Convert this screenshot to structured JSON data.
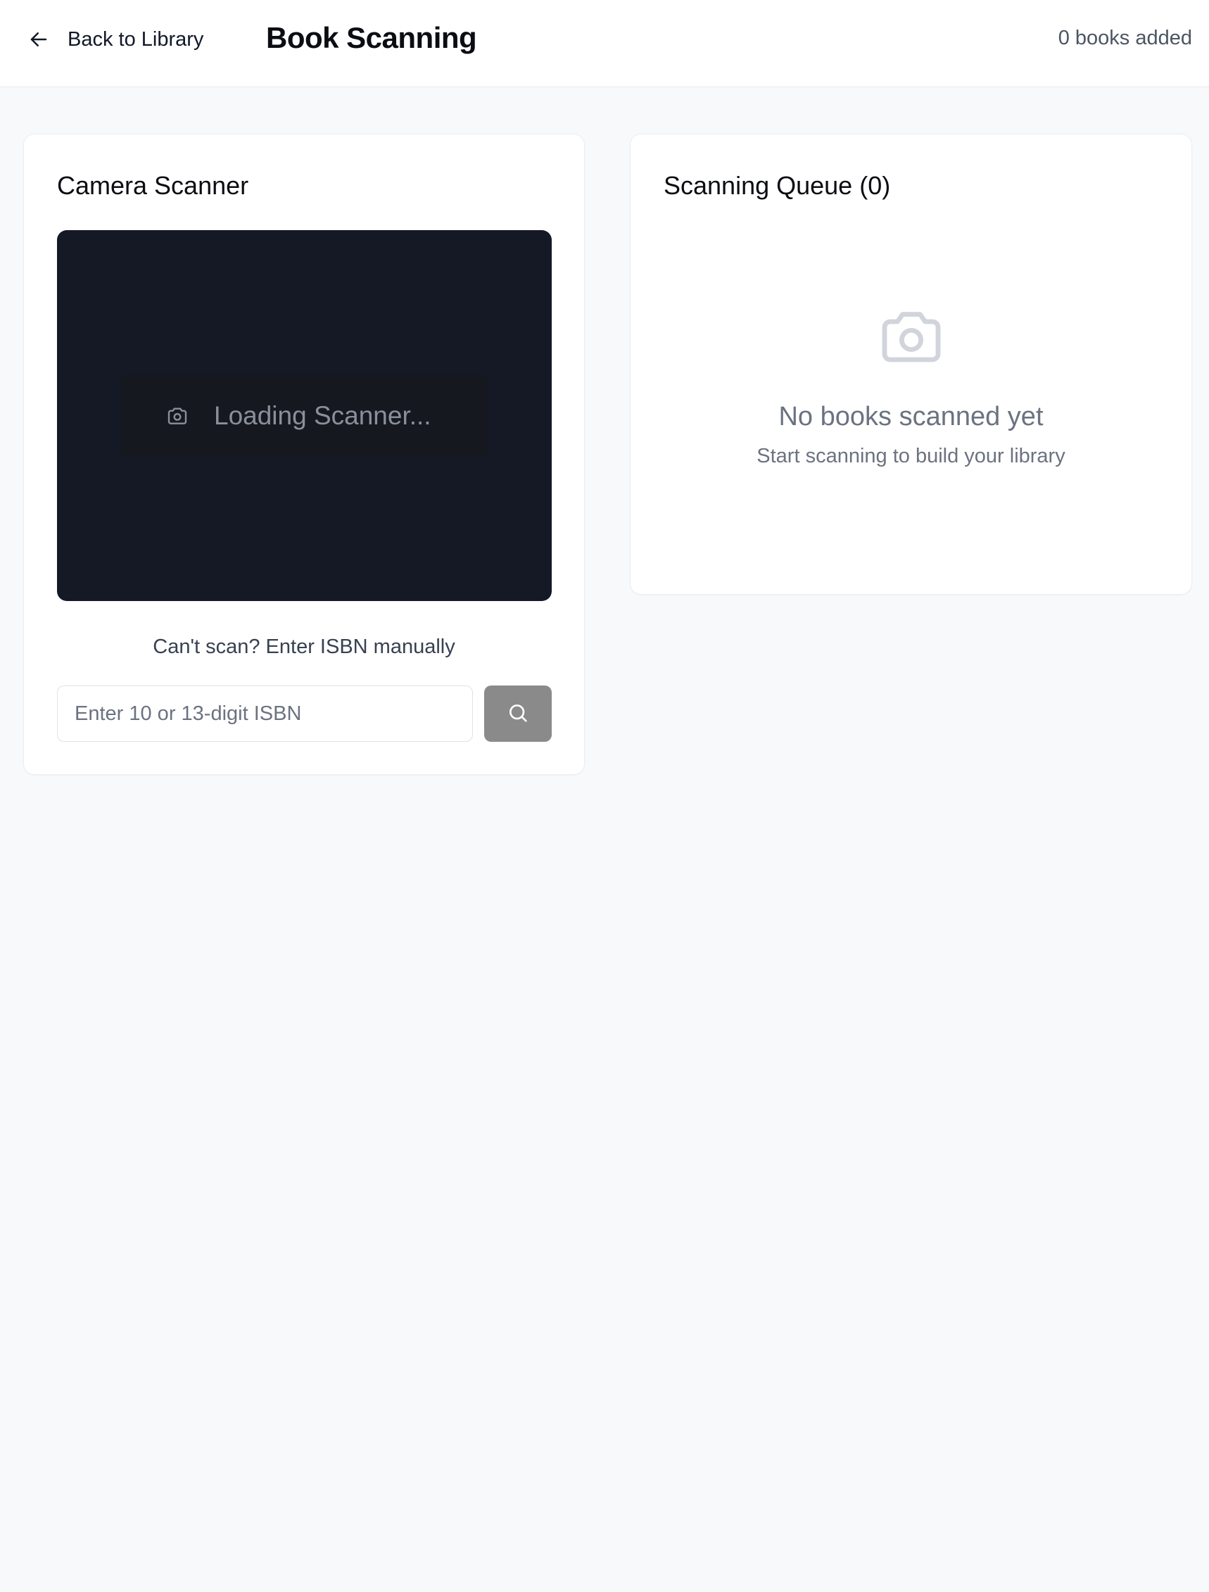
{
  "header": {
    "back_label": "Back to Library",
    "back_icon": "arrow-left-icon",
    "title": "Book Scanning",
    "books_added": "0 books added"
  },
  "scanner": {
    "title": "Camera Scanner",
    "loading_icon": "camera-icon",
    "loading_text": "Loading Scanner...",
    "manual_hint": "Can't scan? Enter ISBN manually",
    "isbn_placeholder": "Enter 10 or 13-digit ISBN",
    "isbn_value": "",
    "search_icon": "search-icon"
  },
  "queue": {
    "title": "Scanning Queue (0)",
    "empty_icon": "camera-icon",
    "empty_title": "No books scanned yet",
    "empty_subtitle": "Start scanning to build your library"
  },
  "colors": {
    "page_bg": "#f8f9fb",
    "card_bg": "#ffffff",
    "scanner_bg": "#141925",
    "search_button_bg": "#8a8a8a",
    "muted_text": "#6b7280"
  }
}
